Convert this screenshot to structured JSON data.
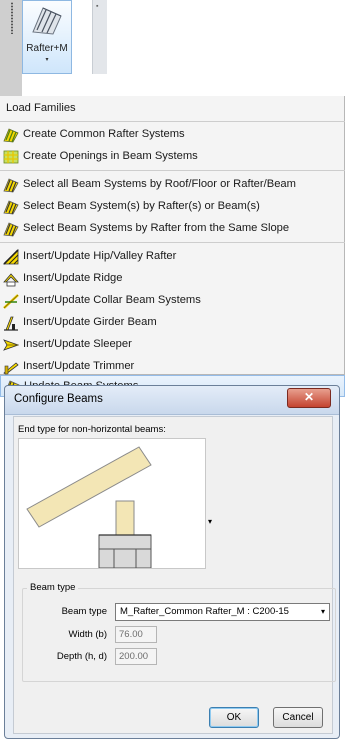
{
  "ribbon": {
    "button_label": "Rafter+M",
    "arrow": "▾",
    "icon": "roof-rafter-icon"
  },
  "menu": {
    "items": [
      {
        "label": "Load Families",
        "icon": ""
      },
      {
        "label": "Create Common Rafter Systems",
        "icon": "rafter-system-icon"
      },
      {
        "label": "Create Openings in Beam Systems",
        "icon": "opening-icon"
      },
      {
        "label": "Select all Beam Systems by Roof/Floor or Rafter/Beam",
        "icon": "select-beam-icon"
      },
      {
        "label": "Select Beam System(s) by Rafter(s) or Beam(s)",
        "icon": "select-beam-icon"
      },
      {
        "label": "Select Beam Systems by Rafter from the Same Slope",
        "icon": "select-beam-icon"
      },
      {
        "label": "Insert/Update Hip/Valley Rafter",
        "icon": "hip-valley-icon"
      },
      {
        "label": "Insert/Update Ridge",
        "icon": "ridge-icon"
      },
      {
        "label": "Insert/Update Collar Beam Systems",
        "icon": "collar-beam-icon"
      },
      {
        "label": "Insert/Update Girder Beam",
        "icon": "girder-beam-icon"
      },
      {
        "label": "Insert/Update Sleeper",
        "icon": "sleeper-icon"
      },
      {
        "label": "Insert/Update Trimmer",
        "icon": "trimmer-icon"
      },
      {
        "label": "Update Beam Systems",
        "icon": "update-beam-icon"
      }
    ]
  },
  "dialog": {
    "title": "Configure Beams",
    "close_glyph": "✕",
    "end_type_label": "End type for non-horizontal beams:",
    "group_title": "Beam type",
    "beam_type_label": "Beam type",
    "beam_type_value": "M_Rafter_Common Rafter_M : C200-15",
    "width_label": "Width (b)",
    "width_value": "76.00",
    "depth_label": "Depth (h, d)",
    "depth_value": "200.00",
    "ok_label": "OK",
    "cancel_label": "Cancel",
    "dropdown_glyph": "▾"
  },
  "colors": {
    "highlight": "#d7e8f8",
    "timber": "#f3e6b5",
    "close_red": "#c4432f"
  }
}
